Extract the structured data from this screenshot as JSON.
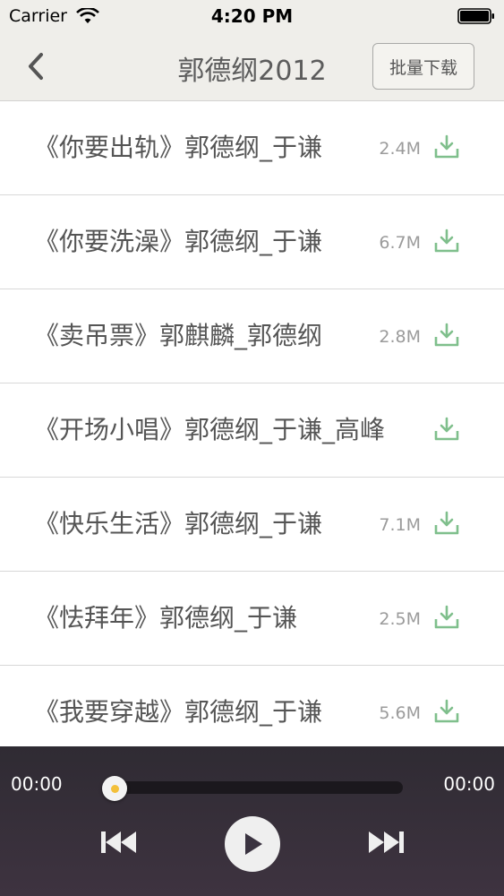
{
  "status_bar": {
    "carrier": "Carrier",
    "time": "4:20 PM"
  },
  "nav": {
    "title": "郭德纲2012",
    "batch_download_label": "批量下载"
  },
  "tracks": [
    {
      "title": "《你要出轨》郭德纲_于谦",
      "size": "2.4M"
    },
    {
      "title": "《你要洗澡》郭德纲_于谦",
      "size": "6.7M"
    },
    {
      "title": "《卖吊票》郭麒麟_郭德纲",
      "size": "2.8M"
    },
    {
      "title": "《开场小唱》郭德纲_于谦_高峰",
      "size": ""
    },
    {
      "title": "《快乐生活》郭德纲_于谦",
      "size": "7.1M"
    },
    {
      "title": "《怯拜年》郭德纲_于谦",
      "size": "2.5M"
    },
    {
      "title": "《我要穿越》郭德纲_于谦",
      "size": "5.6M"
    }
  ],
  "player": {
    "current_time": "00:00",
    "total_time": "00:00",
    "progress": 0
  },
  "colors": {
    "download_green": "#7fbf8c",
    "bar_background": "#efeeea",
    "player_background": "#332d37"
  },
  "icons": {
    "back": "chevron-left-icon",
    "download": "download-icon",
    "previous": "skip-previous-icon",
    "play": "play-icon",
    "next": "skip-next-icon"
  }
}
